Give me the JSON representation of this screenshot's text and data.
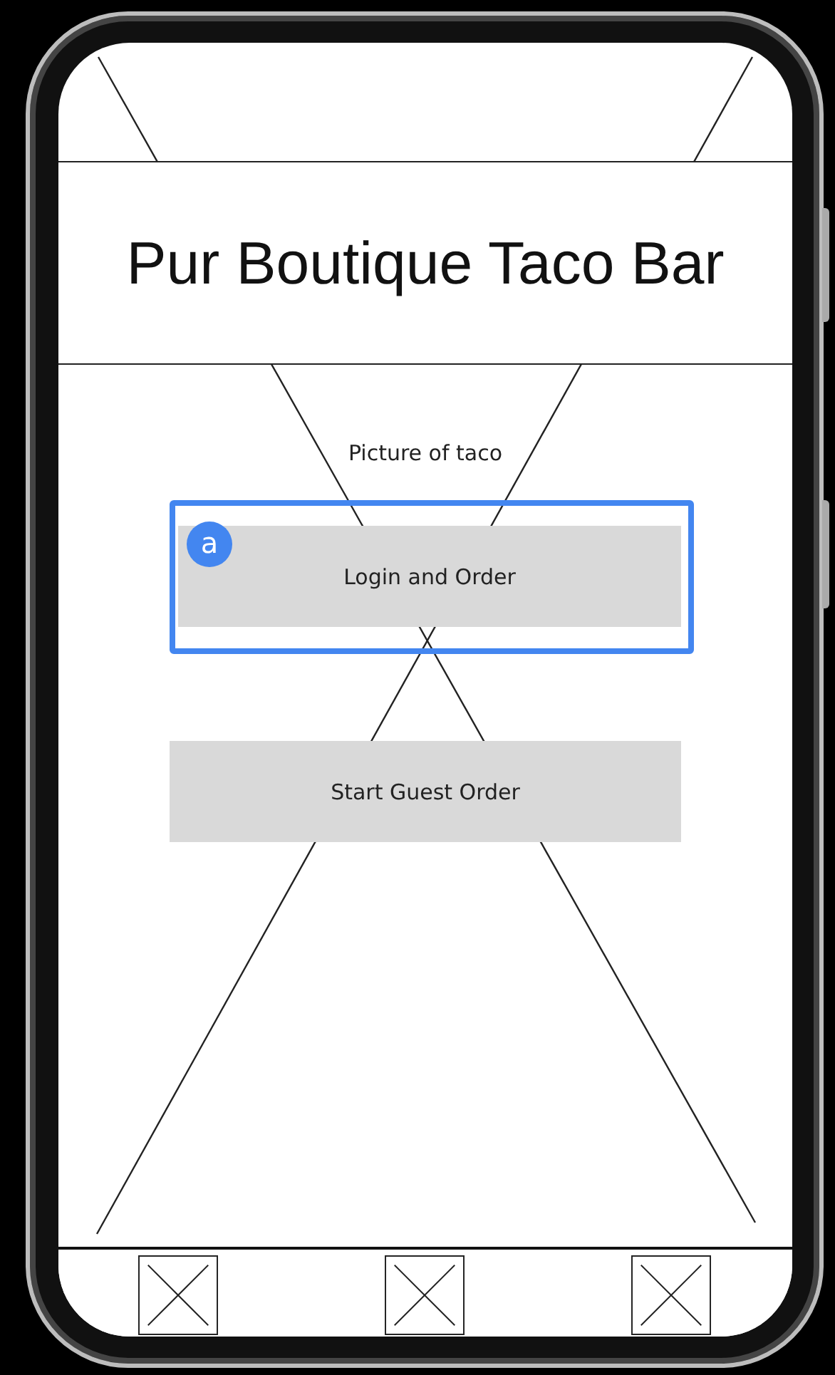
{
  "header": {
    "title": "Pur Boutique Taco Bar"
  },
  "hero": {
    "caption": "Picture of taco"
  },
  "buttons": [
    {
      "label": "Login and Order",
      "highlighted": true,
      "annotation": "a"
    },
    {
      "label": "Start Guest Order",
      "highlighted": false
    }
  ]
}
